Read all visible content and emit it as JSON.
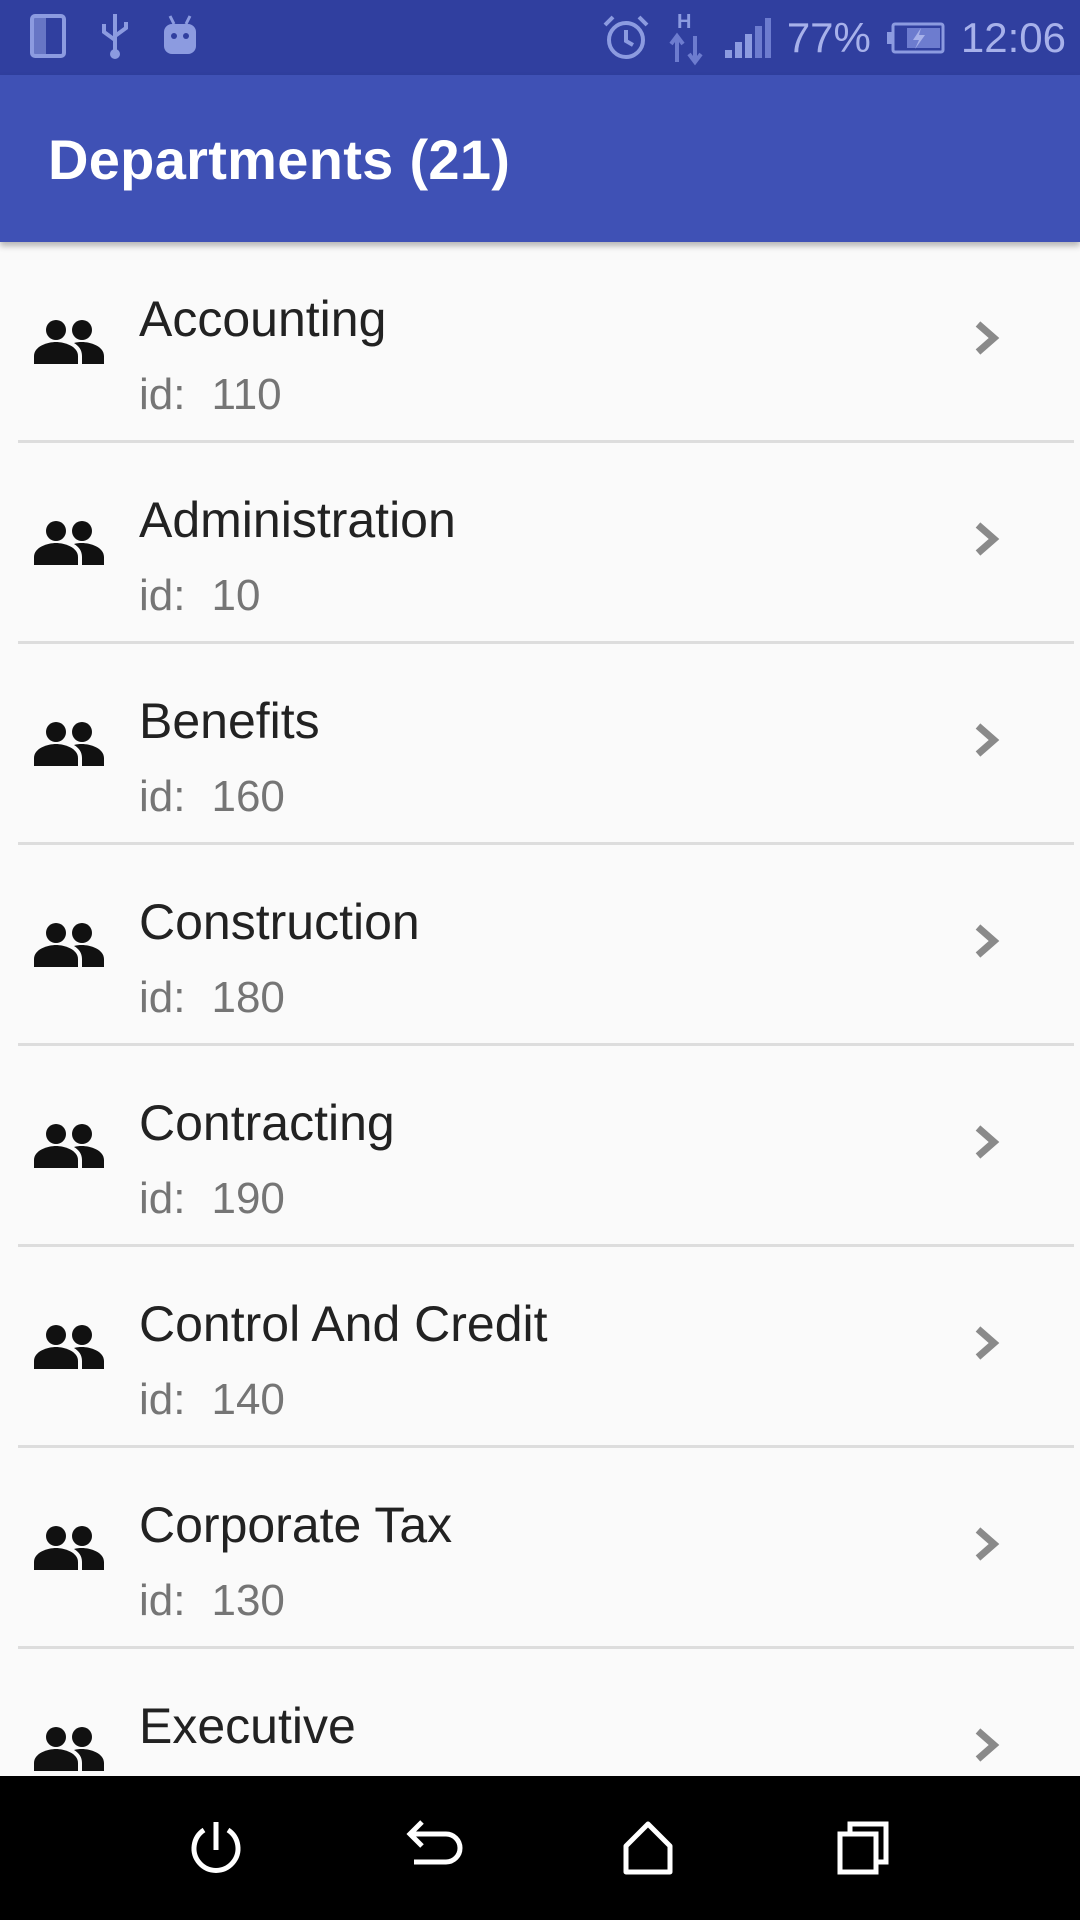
{
  "status_bar": {
    "battery_percent": "77%",
    "time": "12:06",
    "network_type": "H",
    "icons": [
      "device-icon",
      "usb-icon",
      "android-icon",
      "alarm-icon",
      "data-transfer-icon",
      "signal-icon",
      "battery-charging-icon"
    ]
  },
  "app_bar": {
    "title": "Departments (21)"
  },
  "departments": {
    "id_label": "id:",
    "items": [
      {
        "name": "Accounting",
        "id": "110"
      },
      {
        "name": "Administration",
        "id": "10"
      },
      {
        "name": "Benefits",
        "id": "160"
      },
      {
        "name": "Construction",
        "id": "180"
      },
      {
        "name": "Contracting",
        "id": "190"
      },
      {
        "name": "Control And Credit",
        "id": "140"
      },
      {
        "name": "Corporate Tax",
        "id": "130"
      },
      {
        "name": "Executive",
        "id": ""
      }
    ]
  },
  "nav_bar": {
    "buttons": [
      "power-icon",
      "back-icon",
      "home-icon",
      "recents-icon"
    ]
  },
  "colors": {
    "status_bar": "#303f9f",
    "app_bar": "#3f51b5",
    "background": "#fafafa",
    "divider": "#dddddd",
    "nav_bar": "#000000"
  }
}
